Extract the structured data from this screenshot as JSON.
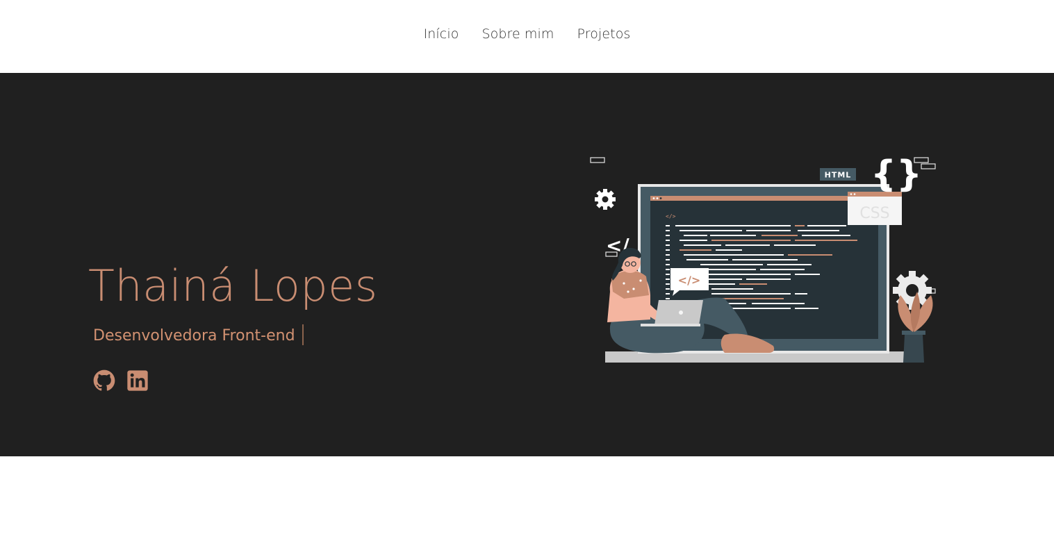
{
  "nav": {
    "items": [
      "Início",
      "Sobre mim",
      "Projetos"
    ]
  },
  "hero": {
    "name": "Thainá Lopes",
    "role": "Desenvolvedora Front-end",
    "social": [
      {
        "icon": "github-icon",
        "label": "GitHub"
      },
      {
        "icon": "linkedin-icon",
        "label": "LinkedIn"
      }
    ]
  },
  "illustration": {
    "tags": [
      "HTML",
      "CSS"
    ],
    "code_symbol": "</>"
  },
  "colors": {
    "accent": "#c98d72",
    "hero_bg": "#202020",
    "page_bg": "#ffffff",
    "nav_text": "#333333"
  }
}
